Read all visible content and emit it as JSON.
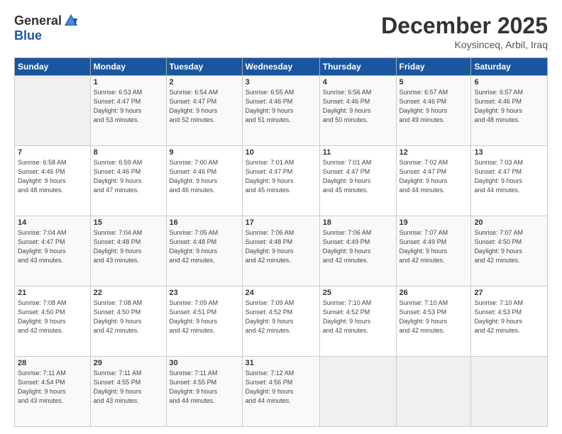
{
  "header": {
    "logo_general": "General",
    "logo_blue": "Blue",
    "month": "December 2025",
    "location": "Koysinceq, Arbil, Iraq"
  },
  "days_of_week": [
    "Sunday",
    "Monday",
    "Tuesday",
    "Wednesday",
    "Thursday",
    "Friday",
    "Saturday"
  ],
  "weeks": [
    [
      {
        "num": "",
        "detail": ""
      },
      {
        "num": "1",
        "detail": "Sunrise: 6:53 AM\nSunset: 4:47 PM\nDaylight: 9 hours\nand 53 minutes."
      },
      {
        "num": "2",
        "detail": "Sunrise: 6:54 AM\nSunset: 4:47 PM\nDaylight: 9 hours\nand 52 minutes."
      },
      {
        "num": "3",
        "detail": "Sunrise: 6:55 AM\nSunset: 4:46 PM\nDaylight: 9 hours\nand 51 minutes."
      },
      {
        "num": "4",
        "detail": "Sunrise: 6:56 AM\nSunset: 4:46 PM\nDaylight: 9 hours\nand 50 minutes."
      },
      {
        "num": "5",
        "detail": "Sunrise: 6:57 AM\nSunset: 4:46 PM\nDaylight: 9 hours\nand 49 minutes."
      },
      {
        "num": "6",
        "detail": "Sunrise: 6:57 AM\nSunset: 4:46 PM\nDaylight: 9 hours\nand 48 minutes."
      }
    ],
    [
      {
        "num": "7",
        "detail": "Sunrise: 6:58 AM\nSunset: 4:46 PM\nDaylight: 9 hours\nand 48 minutes."
      },
      {
        "num": "8",
        "detail": "Sunrise: 6:59 AM\nSunset: 4:46 PM\nDaylight: 9 hours\nand 47 minutes."
      },
      {
        "num": "9",
        "detail": "Sunrise: 7:00 AM\nSunset: 4:46 PM\nDaylight: 9 hours\nand 46 minutes."
      },
      {
        "num": "10",
        "detail": "Sunrise: 7:01 AM\nSunset: 4:47 PM\nDaylight: 9 hours\nand 45 minutes."
      },
      {
        "num": "11",
        "detail": "Sunrise: 7:01 AM\nSunset: 4:47 PM\nDaylight: 9 hours\nand 45 minutes."
      },
      {
        "num": "12",
        "detail": "Sunrise: 7:02 AM\nSunset: 4:47 PM\nDaylight: 9 hours\nand 44 minutes."
      },
      {
        "num": "13",
        "detail": "Sunrise: 7:03 AM\nSunset: 4:47 PM\nDaylight: 9 hours\nand 44 minutes."
      }
    ],
    [
      {
        "num": "14",
        "detail": "Sunrise: 7:04 AM\nSunset: 4:47 PM\nDaylight: 9 hours\nand 43 minutes."
      },
      {
        "num": "15",
        "detail": "Sunrise: 7:04 AM\nSunset: 4:48 PM\nDaylight: 9 hours\nand 43 minutes."
      },
      {
        "num": "16",
        "detail": "Sunrise: 7:05 AM\nSunset: 4:48 PM\nDaylight: 9 hours\nand 42 minutes."
      },
      {
        "num": "17",
        "detail": "Sunrise: 7:06 AM\nSunset: 4:48 PM\nDaylight: 9 hours\nand 42 minutes."
      },
      {
        "num": "18",
        "detail": "Sunrise: 7:06 AM\nSunset: 4:49 PM\nDaylight: 9 hours\nand 42 minutes."
      },
      {
        "num": "19",
        "detail": "Sunrise: 7:07 AM\nSunset: 4:49 PM\nDaylight: 9 hours\nand 42 minutes."
      },
      {
        "num": "20",
        "detail": "Sunrise: 7:07 AM\nSunset: 4:50 PM\nDaylight: 9 hours\nand 42 minutes."
      }
    ],
    [
      {
        "num": "21",
        "detail": "Sunrise: 7:08 AM\nSunset: 4:50 PM\nDaylight: 9 hours\nand 42 minutes."
      },
      {
        "num": "22",
        "detail": "Sunrise: 7:08 AM\nSunset: 4:50 PM\nDaylight: 9 hours\nand 42 minutes."
      },
      {
        "num": "23",
        "detail": "Sunrise: 7:09 AM\nSunset: 4:51 PM\nDaylight: 9 hours\nand 42 minutes."
      },
      {
        "num": "24",
        "detail": "Sunrise: 7:09 AM\nSunset: 4:52 PM\nDaylight: 9 hours\nand 42 minutes."
      },
      {
        "num": "25",
        "detail": "Sunrise: 7:10 AM\nSunset: 4:52 PM\nDaylight: 9 hours\nand 42 minutes."
      },
      {
        "num": "26",
        "detail": "Sunrise: 7:10 AM\nSunset: 4:53 PM\nDaylight: 9 hours\nand 42 minutes."
      },
      {
        "num": "27",
        "detail": "Sunrise: 7:10 AM\nSunset: 4:53 PM\nDaylight: 9 hours\nand 42 minutes."
      }
    ],
    [
      {
        "num": "28",
        "detail": "Sunrise: 7:11 AM\nSunset: 4:54 PM\nDaylight: 9 hours\nand 43 minutes."
      },
      {
        "num": "29",
        "detail": "Sunrise: 7:11 AM\nSunset: 4:55 PM\nDaylight: 9 hours\nand 43 minutes."
      },
      {
        "num": "30",
        "detail": "Sunrise: 7:11 AM\nSunset: 4:55 PM\nDaylight: 9 hours\nand 44 minutes."
      },
      {
        "num": "31",
        "detail": "Sunrise: 7:12 AM\nSunset: 4:56 PM\nDaylight: 9 hours\nand 44 minutes."
      },
      {
        "num": "",
        "detail": ""
      },
      {
        "num": "",
        "detail": ""
      },
      {
        "num": "",
        "detail": ""
      }
    ]
  ]
}
